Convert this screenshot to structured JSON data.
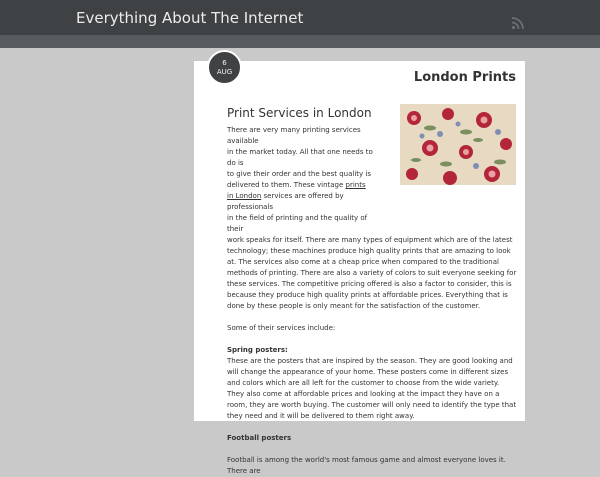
{
  "header": {
    "site_title": "Everything About The Internet",
    "rss_icon": "rss-icon"
  },
  "post": {
    "date": {
      "day": "6",
      "month": "AUG"
    },
    "title": "London Prints",
    "image_icon": "floral-fabric-image",
    "heading": "Print Services in London",
    "p1_line1": "There are very many printing services available",
    "p1_line2": "in the market today. All that one needs to do is",
    "p1_line3": "to give their order and the best quality is",
    "p1_line4_pre": "delivered to them. These vintage ",
    "p1_link_part1": "prints",
    "p1_link_part2": "in London",
    "p1_line5_post": " services are offered by professionals",
    "p1_line6": "in the field of printing and the quality of their",
    "p1_rest": "work speaks for itself. There are many types of equipment which are of the latest technology; these machines produce high quality prints that are amazing to look at. The services also come at a cheap price when compared to the traditional methods of printing. There are also a variety of colors to suit everyone seeking for these services. The competitive pricing offered is also a factor to consider, this is because they produce high quality prints at affordable prices. Everything that is done by these people is only meant for the satisfaction of the customer.",
    "p2": "Some of their services include:",
    "spring_heading": "Spring posters:",
    "spring_text": "These are the posters that are inspired by the season. They are good looking and will change the appearance of your home. These posters come in different sizes and colors which are all left for the customer to choose from the wide variety. They also come at affordable prices and looking at the impact they have on a room, they are worth buying. The customer will only need to identify the type that they need and it will be delivered to them right away.",
    "football_heading": "Football posters",
    "football_text": "Football is among the world's most famous game and almost everyone loves it. There are"
  }
}
